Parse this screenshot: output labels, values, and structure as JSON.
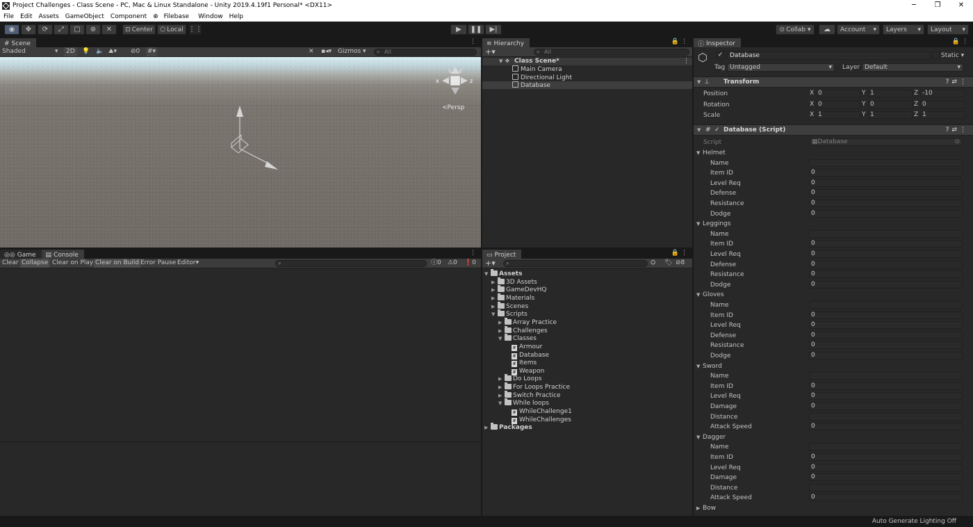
{
  "window": {
    "title": "Project Challenges - Class Scene - PC, Mac & Linux Standalone - Unity 2019.4.19f1 Personal* <DX11>",
    "controls": [
      "─",
      "❐",
      "✕"
    ]
  },
  "menu": [
    "File",
    "Edit",
    "Assets",
    "GameObject",
    "Component",
    "Filebase",
    "Window",
    "Help"
  ],
  "toolbar": {
    "pivot_label": "Center",
    "space_label": "Local",
    "collab_label": "Collab ▾",
    "account_label": "Account",
    "layers_label": "Layers",
    "layout_label": "Layout"
  },
  "scene": {
    "tab": "Scene",
    "shading": "Shaded",
    "mode_2d": "2D",
    "hidden_count": "0",
    "gizmos_label": "Gizmos",
    "search_placeholder": "All",
    "persp_label": "<Persp"
  },
  "hierarchy": {
    "tab": "Hierarchy",
    "search_placeholder": "All",
    "root": "Class Scene*",
    "items": [
      "Main Camera",
      "Directional Light",
      "Database"
    ]
  },
  "console": {
    "tabs": [
      "Game",
      "Console"
    ],
    "buttons": [
      "Clear",
      "Collapse",
      "Clear on Play",
      "Clear on Build",
      "Error Pause",
      "Editor"
    ],
    "counts": {
      "info": "0",
      "warn": "0",
      "error": "0"
    }
  },
  "project": {
    "tab": "Project",
    "hidden_count": "8",
    "tree": [
      {
        "label": "Assets",
        "depth": 0,
        "kind": "folder",
        "open": true,
        "bold": true
      },
      {
        "label": "3D Assets",
        "depth": 1,
        "kind": "folder",
        "open": false
      },
      {
        "label": "GameDevHQ",
        "depth": 1,
        "kind": "folder",
        "open": false
      },
      {
        "label": "Materials",
        "depth": 1,
        "kind": "folder",
        "open": false
      },
      {
        "label": "Scenes",
        "depth": 1,
        "kind": "folder",
        "open": false
      },
      {
        "label": "Scripts",
        "depth": 1,
        "kind": "folder",
        "open": true
      },
      {
        "label": "Array Practice",
        "depth": 2,
        "kind": "folder",
        "open": false
      },
      {
        "label": "Challenges",
        "depth": 2,
        "kind": "folder",
        "open": false
      },
      {
        "label": "Classes",
        "depth": 2,
        "kind": "folder",
        "open": true
      },
      {
        "label": "Armour",
        "depth": 3,
        "kind": "file"
      },
      {
        "label": "Database",
        "depth": 3,
        "kind": "file"
      },
      {
        "label": "Items",
        "depth": 3,
        "kind": "file"
      },
      {
        "label": "Weapon",
        "depth": 3,
        "kind": "file"
      },
      {
        "label": "Do Loops",
        "depth": 2,
        "kind": "folder",
        "open": false
      },
      {
        "label": "For Loops Practice",
        "depth": 2,
        "kind": "folder",
        "open": false
      },
      {
        "label": "Switch Practice",
        "depth": 2,
        "kind": "folder",
        "open": false
      },
      {
        "label": "While loops",
        "depth": 2,
        "kind": "folder",
        "open": true
      },
      {
        "label": "WhileChallenge1",
        "depth": 3,
        "kind": "file"
      },
      {
        "label": "WhileChallenges",
        "depth": 3,
        "kind": "file"
      },
      {
        "label": "Packages",
        "depth": 0,
        "kind": "folder",
        "open": false,
        "bold": true
      }
    ]
  },
  "inspector": {
    "tab": "Inspector",
    "object_name": "Database",
    "static_label": "Static",
    "tag_label": "Tag",
    "tag_value": "Untagged",
    "layer_label": "Layer",
    "layer_value": "Default",
    "transform": {
      "title": "Transform",
      "rows": [
        {
          "label": "Position",
          "x": "0",
          "y": "1",
          "z": "-10"
        },
        {
          "label": "Rotation",
          "x": "0",
          "y": "0",
          "z": "0"
        },
        {
          "label": "Scale",
          "x": "1",
          "y": "1",
          "z": "1"
        }
      ]
    },
    "script_component": {
      "title": "Database (Script)",
      "script_label": "Script",
      "script_value": "Database"
    },
    "groups": [
      {
        "name": "Helmet",
        "fields": [
          [
            "Name",
            ""
          ],
          [
            "Item ID",
            "0"
          ],
          [
            "Level Req",
            "0"
          ],
          [
            "Defense",
            "0"
          ],
          [
            "Resistance",
            "0"
          ],
          [
            "Dodge",
            "0"
          ]
        ]
      },
      {
        "name": "Leggings",
        "fields": [
          [
            "Name",
            ""
          ],
          [
            "Item ID",
            "0"
          ],
          [
            "Level Req",
            "0"
          ],
          [
            "Defense",
            "0"
          ],
          [
            "Resistance",
            "0"
          ],
          [
            "Dodge",
            "0"
          ]
        ]
      },
      {
        "name": "Gloves",
        "fields": [
          [
            "Name",
            ""
          ],
          [
            "Item ID",
            "0"
          ],
          [
            "Level Req",
            "0"
          ],
          [
            "Defense",
            "0"
          ],
          [
            "Resistance",
            "0"
          ],
          [
            "Dodge",
            "0"
          ]
        ]
      },
      {
        "name": "Sword",
        "fields": [
          [
            "Name",
            ""
          ],
          [
            "Item ID",
            "0"
          ],
          [
            "Level Req",
            "0"
          ],
          [
            "Damage",
            "0"
          ],
          [
            "Distance",
            ""
          ],
          [
            "Attack Speed",
            "0"
          ]
        ]
      },
      {
        "name": "Dagger",
        "fields": [
          [
            "Name",
            ""
          ],
          [
            "Item ID",
            "0"
          ],
          [
            "Level Req",
            "0"
          ],
          [
            "Damage",
            "0"
          ],
          [
            "Distance",
            ""
          ],
          [
            "Attack Speed",
            "0"
          ]
        ]
      },
      {
        "name": "Bow",
        "fields": []
      }
    ]
  },
  "status": {
    "right": "Auto Generate Lighting Off"
  },
  "colors": {
    "accent": "#4d5d74",
    "panel": "#282828",
    "header": "#3c3c3c",
    "selection": "#3e3e3e"
  }
}
